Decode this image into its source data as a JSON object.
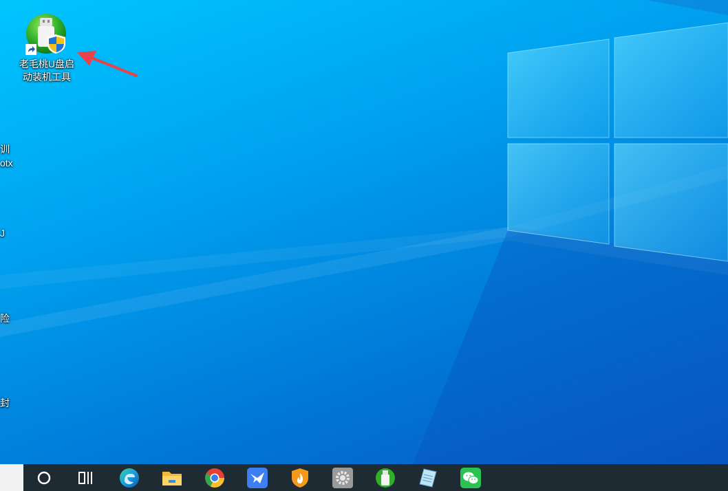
{
  "desktop": {
    "icon": {
      "label_line1": "老毛桃U盘启",
      "label_line2": "动装机工具",
      "icon_name": "usb-boot-tool-icon"
    },
    "partial_labels": [
      {
        "text": "训"
      },
      {
        "text": "otx"
      },
      {
        "text": "J"
      },
      {
        "text": "险"
      },
      {
        "text": "封"
      }
    ],
    "annotation": "red-arrow-pointer"
  },
  "taskbar": {
    "items": [
      {
        "name": "start-button",
        "icon": "windows-logo"
      },
      {
        "name": "search-circle",
        "icon": "circle-icon"
      },
      {
        "name": "task-view",
        "icon": "task-view-icon"
      },
      {
        "name": "edge",
        "icon": "edge-icon"
      },
      {
        "name": "file-explorer",
        "icon": "folder-icon"
      },
      {
        "name": "chrome",
        "icon": "chrome-icon"
      },
      {
        "name": "feishu",
        "icon": "bird-icon"
      },
      {
        "name": "security",
        "icon": "shield-flame-icon"
      },
      {
        "name": "settings",
        "icon": "gear-icon"
      },
      {
        "name": "usb-tool",
        "icon": "usb-icon"
      },
      {
        "name": "notepad",
        "icon": "notepad-icon"
      },
      {
        "name": "wechat",
        "icon": "wechat-icon"
      }
    ]
  },
  "colors": {
    "wallpaper_light": "#00c6ff",
    "wallpaper_dark": "#0a57c4",
    "taskbar": "#1f2b33",
    "arrow": "#e8424a"
  }
}
